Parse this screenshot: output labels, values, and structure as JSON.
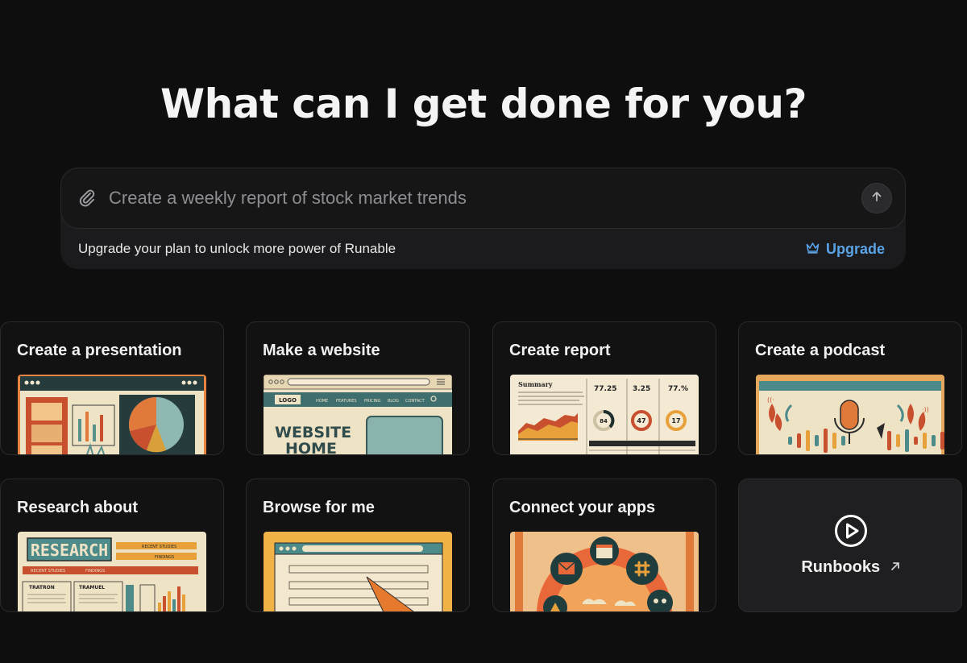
{
  "headline": "What can I get done for you?",
  "composer": {
    "placeholder": "Create a weekly report of stock market trends",
    "attach_icon": "paperclip-icon",
    "send_icon": "arrow-up-icon",
    "upgrade_note": "Upgrade your plan to unlock more power of Runable",
    "upgrade_label": "Upgrade",
    "upgrade_icon": "crown-icon",
    "accent_color": "#5aa2e6"
  },
  "cards": [
    {
      "title": "Create a presentation"
    },
    {
      "title": "Make a website",
      "thumb_texts": [
        "LOGO",
        "HOME",
        "FEATURES",
        "PRICING",
        "BLOG",
        "CONTACT",
        "WEBSITE",
        "HOME"
      ]
    },
    {
      "title": "Create report",
      "thumb_texts": [
        "Summary",
        "77.25",
        "3.25",
        "77.%",
        "84",
        "47",
        "17"
      ]
    },
    {
      "title": "Create a podcast"
    },
    {
      "title": "Research about",
      "thumb_texts": [
        "RESEARCH",
        "RECENT STUDIES",
        "FINDINGS",
        "RECENT STUDIES",
        "FINDINGS",
        "TRATRON",
        "TRAMUEL"
      ]
    },
    {
      "title": "Browse for me"
    },
    {
      "title": "Connect your apps"
    }
  ],
  "runbooks": {
    "label": "Runbooks",
    "icon": "play-circle-icon",
    "arrow_icon": "arrow-up-right-icon"
  },
  "colors": {
    "background": "#0e0e0f",
    "card": "#121213",
    "thumb_cream": "#efe3c6",
    "thumb_teal": "#4d8a8a",
    "thumb_orange": "#d86f35"
  }
}
